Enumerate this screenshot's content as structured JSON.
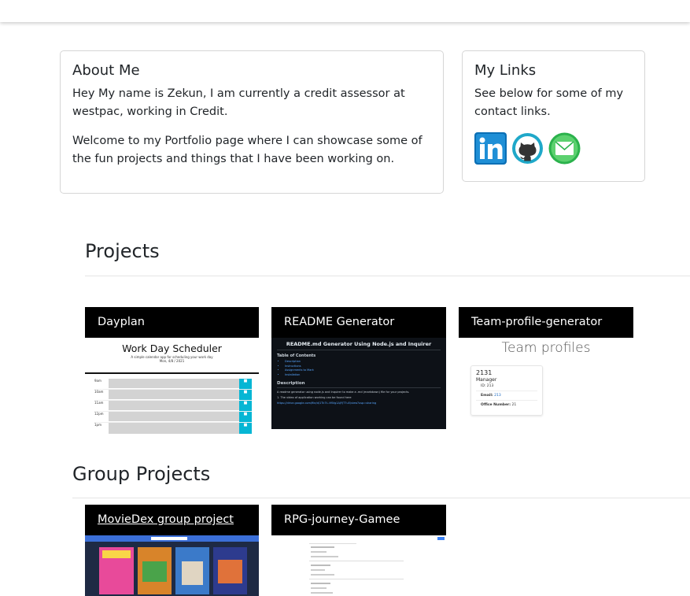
{
  "about": {
    "title": "About Me",
    "p1": "Hey My name is Zekun, I am currently a credit assessor at westpac, working in Credit.",
    "p2": "Welcome to my Portfolio page where I can showcase some of the fun projects and things that I have been working on."
  },
  "links": {
    "title": "My Links",
    "text": "See below for some of my contact links.",
    "icons": [
      "linkedin-icon",
      "github-icon",
      "email-icon"
    ]
  },
  "projects": {
    "title": "Projects",
    "items": [
      {
        "name": "Dayplan",
        "thumb_title": "Work Day Scheduler",
        "thumb_subtitle": "A simple calendar app for scheduling your work day",
        "thumb_date": "Mon, 4/8 / 2021",
        "hours": [
          "9am",
          "10am",
          "11am",
          "12pm",
          "1pm"
        ]
      },
      {
        "name": "README Generator",
        "thumb_title": "README.md Generator Using Node.js and Inquirer",
        "thumb_toc": "Table of Contents",
        "thumb_toc_items": [
          "Description",
          "Instructions",
          "Assignments to Mark",
          "Installation"
        ],
        "thumb_desc_heading": "Description",
        "thumb_desc_line1": "A readme generator using node.js and Inquirer to make a .md (markdown) file for your projects.",
        "thumb_desc_line2": "1. The video of application working can be found here",
        "thumb_desc_line3": "https://drive.google.com/file/d/1Tk7t..tMVg1AJYJT7u5/view?usp=sharing"
      },
      {
        "name": "Team-profile-generator",
        "thumb_title": "Team profiles",
        "card_name": "2131",
        "card_role": "Manager",
        "card_id": "ID: 213",
        "card_email_label": "Email:",
        "card_email": "213",
        "card_office_label": "Office Number:",
        "card_office": "21"
      }
    ]
  },
  "group": {
    "title": "Group Projects",
    "items": [
      {
        "name": "MovieDex group project"
      },
      {
        "name": "RPG-journey-Gamee"
      }
    ]
  },
  "colors": {
    "bar": "#000000",
    "readme_bg": "#0d1117",
    "scheduler_button": "#06b6d4",
    "moviedex_nav": "#3b6fd8",
    "moviedex_bg": "#1e2a44"
  }
}
